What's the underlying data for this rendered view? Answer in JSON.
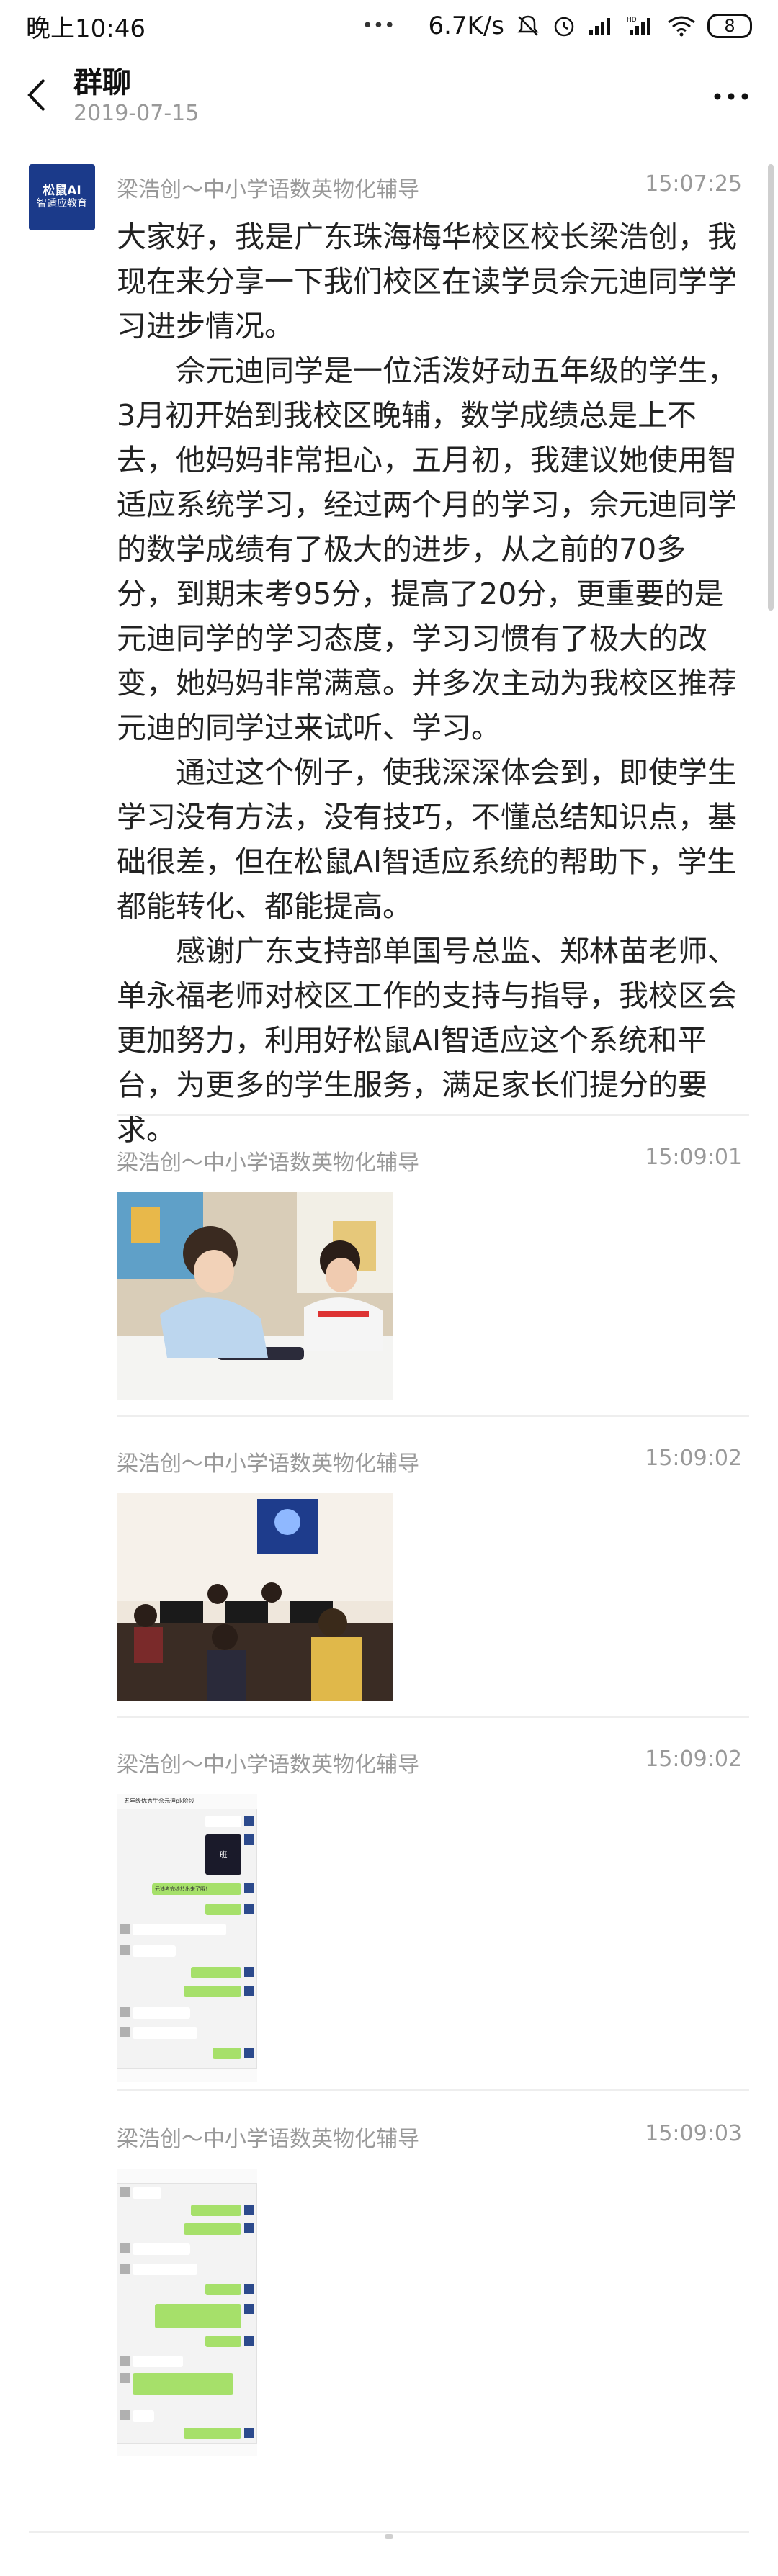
{
  "status_bar": {
    "time": "晚上10:46",
    "dots": "•••",
    "speed": "6.7K/s",
    "battery": "8"
  },
  "header": {
    "title": "群聊",
    "date": "2019-07-15"
  },
  "avatar": {
    "line1": "松鼠AI",
    "line2": "智适应教育"
  },
  "messages": [
    {
      "sender": "梁浩创～中小学语数英物化辅导",
      "time": "15:07:25",
      "paragraphs": [
        "大家好，我是广东珠海梅华校区校长梁浩创，我现在来分享一下我们校区在读学员佘元迪同学学习进步情况。",
        "佘元迪同学是一位活泼好动五年级的学生，3月初开始到我校区晚辅，数学成绩总是上不去，他妈妈非常担心，五月初，我建议她使用智适应系统学习，经过两个月的学习，佘元迪同学的数学成绩有了极大的进步，从之前的70多分，到期末考95分，提高了20分，更重要的是元迪同学的学习态度，学习习惯有了极大的改变，她妈妈非常满意。并多次主动为我校区推荐元迪的同学过来试听、学习。",
        "通过这个例子，使我深深体会到，即使学生学习没有方法，没有技巧，不懂总结知识点，基础很差，但在松鼠AI智适应系统的帮助下，学生都能转化、都能提高。",
        "感谢广东支持部单国号总监、郑林苗老师、单永福老师对校区工作的支持与指导，我校区会更加努力，利用好松鼠AI智适应这个系统和平台，为更多的学生服务，满足家长们提分的要求。"
      ]
    },
    {
      "sender": "梁浩创～中小学语数英物化辅导",
      "time": "15:09:01"
    },
    {
      "sender": "梁浩创～中小学语数英物化辅导",
      "time": "15:09:02"
    },
    {
      "sender": "梁浩创～中小学语数英物化辅导",
      "time": "15:09:02"
    },
    {
      "sender": "梁浩创～中小学语数英物化辅导",
      "time": "15:09:03"
    }
  ],
  "screenshots": {
    "header_title": "五年级优秀生佘元迪pk阶段",
    "badge": "班",
    "chat_line": "元迪考完终於出来了哦！"
  }
}
